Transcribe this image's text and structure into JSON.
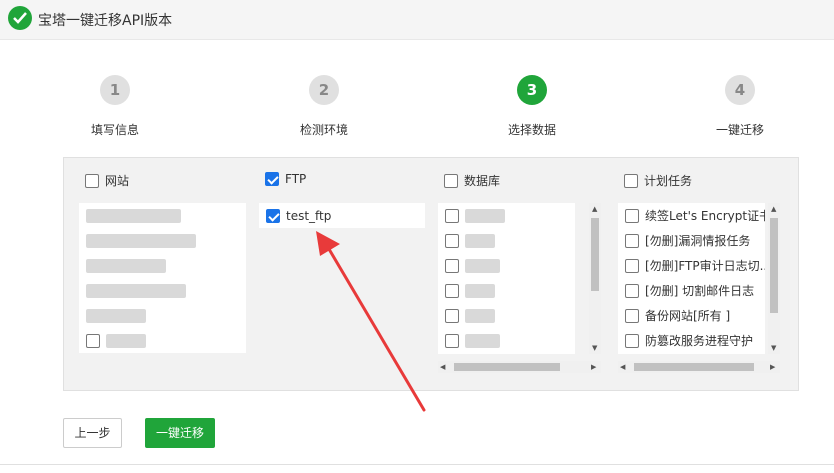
{
  "header": {
    "title": "宝塔一键迁移API版本"
  },
  "steps": [
    {
      "num": "1",
      "label": "填写信息"
    },
    {
      "num": "2",
      "label": "检测环境"
    },
    {
      "num": "3",
      "label": "选择数据"
    },
    {
      "num": "4",
      "label": "一键迁移"
    }
  ],
  "columns": {
    "website": {
      "label": "网站"
    },
    "ftp": {
      "label": "FTP",
      "items": [
        {
          "label": "test_ftp"
        }
      ]
    },
    "database": {
      "label": "数据库"
    },
    "cron": {
      "label": "计划任务",
      "items": [
        {
          "label": "续签Let's Encrypt证书"
        },
        {
          "label": "[勿删]漏洞情报任务"
        },
        {
          "label": "[勿删]FTP审计日志切..."
        },
        {
          "label": "[勿删] 切割邮件日志"
        },
        {
          "label": "备份网站[所有 ]"
        },
        {
          "label": "防篡改服务进程守护"
        }
      ]
    }
  },
  "buttons": {
    "prev": "上一步",
    "migrate": "一键迁移"
  },
  "colors": {
    "accent": "#20a53a",
    "checkbox": "#1a73e8",
    "annotation": "#e83a3a"
  }
}
